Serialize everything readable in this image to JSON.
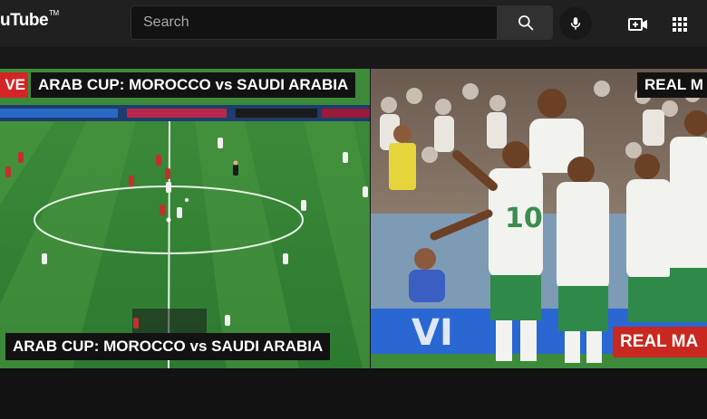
{
  "header": {
    "logo_text": "uTube",
    "logo_mark": "TM",
    "search_placeholder": "Search",
    "icons": [
      "search-icon",
      "microphone-icon",
      "video-create-icon",
      "apps-grid-icon"
    ]
  },
  "videos": [
    {
      "live_badge": "VE",
      "top_caption": "ARAB CUP: MOROCCO vs SAUDI ARABIA",
      "bottom_caption": "ARAB CUP: MOROCCO vs SAUDI ARABIA"
    },
    {
      "top_caption": "REAL M",
      "bottom_caption": "REAL MA"
    }
  ],
  "colors": {
    "background": "#181818",
    "topbar": "#202020",
    "live_red": "#d32525",
    "saudi_green": "#2f8a4a",
    "caption_red": "#c8281f"
  }
}
